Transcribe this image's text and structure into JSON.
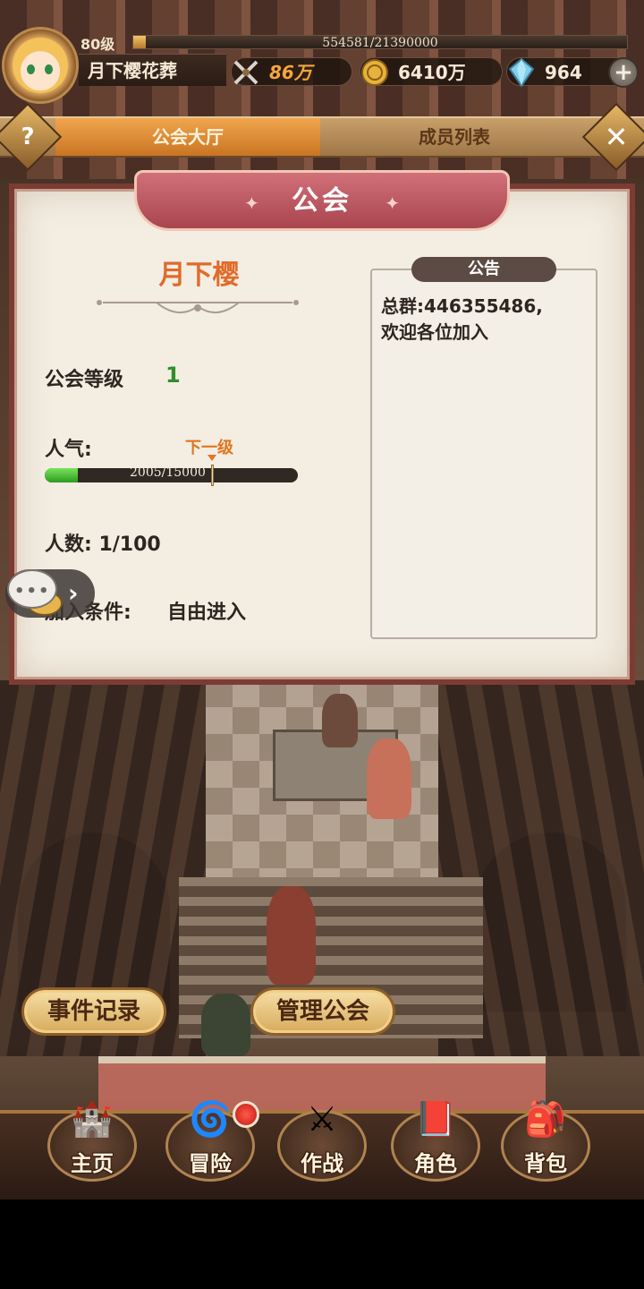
{
  "player": {
    "level": "80级",
    "exp_text": "554581/21390000",
    "exp_fraction": 0.026,
    "name": "月下樱花葬",
    "power": "86万",
    "gold": "6410万",
    "gems": "964",
    "add_label": "+"
  },
  "tabs": {
    "help": "?",
    "hall": "公会大厅",
    "members": "成员列表",
    "close": "✕"
  },
  "guild": {
    "panel_title": "公会",
    "name": "月下樱",
    "level_label": "公会等级",
    "level_value": "1",
    "popularity_label": "人气:",
    "next_level_label": "下一级",
    "popularity_text": "2005/15000",
    "popularity_fraction": 0.13,
    "members_label": "人数: 1/100",
    "join_label": "加入条件:",
    "join_value": "自由进入",
    "notice_tag": "公告",
    "notice_text": "总群:446355486,\n欢迎各位加入"
  },
  "actions": {
    "event_log": "事件记录",
    "manage_guild": "管理公会"
  },
  "nav": {
    "home": "主页",
    "adventure": "冒险",
    "battle": "作战",
    "character": "角色",
    "bag": "背包"
  },
  "colors": {
    "accent_orange": "#e06b2a",
    "level_green": "#2f8f2a",
    "panel_border": "#7c3b33"
  }
}
